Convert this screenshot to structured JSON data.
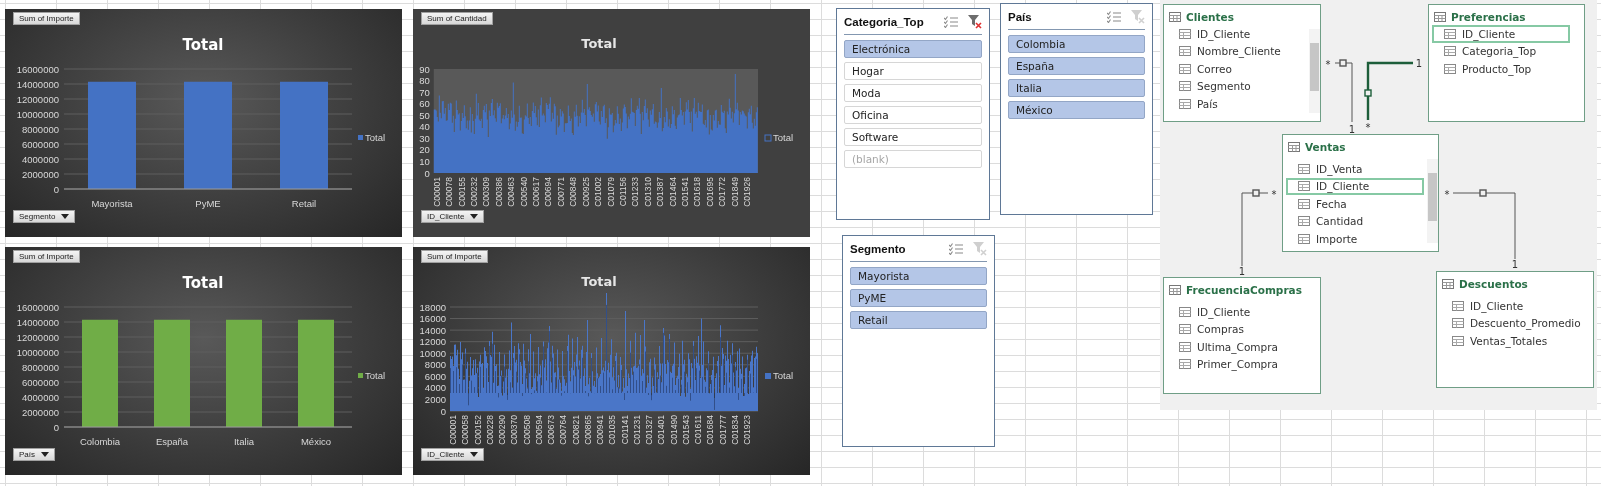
{
  "charts": [
    {
      "kind": "bar_chart",
      "field_button": "Sum of Importe",
      "axis_button": "Segmento",
      "chart_data": {
        "type": "bar",
        "title": "Total",
        "categories": [
          "Mayorista",
          "PyME",
          "Retail"
        ],
        "series": [
          {
            "name": "Total",
            "color": "#4472c4",
            "values": [
              14300000,
              14300000,
              14300000
            ]
          }
        ],
        "grid": true,
        "ylim": [
          0,
          16000000
        ],
        "yticks": [
          0,
          2000000,
          4000000,
          6000000,
          8000000,
          10000000,
          12000000,
          14000000,
          16000000
        ]
      }
    },
    {
      "kind": "dense_chart",
      "field_button": "Sum of Cantidad",
      "axis_button": "ID_Cliente",
      "title": "Total",
      "legend": "Total",
      "y_ticks": [
        "90",
        "80",
        "70",
        "60",
        "50",
        "40",
        "30",
        "20",
        "10",
        "0"
      ],
      "x_labels": [
        "C00001",
        "C00078",
        "C00155",
        "C00232",
        "C00309",
        "C00386",
        "C00463",
        "C00540",
        "C00617",
        "C00694",
        "C00771",
        "C00848",
        "C00925",
        "C01002",
        "C01079",
        "C01156",
        "C01233",
        "C01310",
        "C01387",
        "C01464",
        "C01541",
        "C01618",
        "C01695",
        "C01772",
        "C01849",
        "C01926"
      ]
    },
    {
      "kind": "bar_chart",
      "field_button": "Sum of Importe",
      "axis_button": "País",
      "chart_data": {
        "type": "bar",
        "title": "Total",
        "categories": [
          "Colombia",
          "España",
          "Italia",
          "México"
        ],
        "series": [
          {
            "name": "Total",
            "color": "#70ad47",
            "values": [
              14300000,
              14300000,
              14300000,
              14300000
            ]
          }
        ],
        "grid": true,
        "ylim": [
          0,
          16000000
        ],
        "yticks": [
          0,
          2000000,
          4000000,
          6000000,
          8000000,
          10000000,
          12000000,
          14000000,
          16000000
        ]
      }
    },
    {
      "kind": "dense_chart",
      "field_button": "Sum of Importe",
      "axis_button": "ID_Cliente",
      "title": "Total",
      "legend": "Total",
      "y_ticks": [
        "18000",
        "16000",
        "14000",
        "12000",
        "10000",
        "8000",
        "6000",
        "4000",
        "2000",
        "0"
      ],
      "x_labels": [
        "C00001",
        "C00058",
        "C00152",
        "C00228",
        "C00290",
        "C00370",
        "C00508",
        "C00594",
        "C00673",
        "C00764",
        "C00821",
        "C00865",
        "C00941",
        "C01035",
        "C01141",
        "C01231",
        "C01327",
        "C01401",
        "C01490",
        "C01543",
        "C01611",
        "C01684",
        "C01777",
        "C01834",
        "C01923"
      ]
    }
  ],
  "slicers": [
    {
      "title": "Categoria_Top",
      "filter_active": true,
      "items": [
        {
          "label": "Electrónica",
          "selected": true,
          "disabled": false
        },
        {
          "label": "Hogar",
          "selected": false,
          "disabled": false
        },
        {
          "label": "Moda",
          "selected": false,
          "disabled": false
        },
        {
          "label": "Oficina",
          "selected": false,
          "disabled": false
        },
        {
          "label": "Software",
          "selected": false,
          "disabled": false
        },
        {
          "label": "(blank)",
          "selected": false,
          "disabled": true
        }
      ]
    },
    {
      "title": "País",
      "filter_active": false,
      "items": [
        {
          "label": "Colombia",
          "selected": true,
          "disabled": false
        },
        {
          "label": "España",
          "selected": true,
          "disabled": false
        },
        {
          "label": "Italia",
          "selected": true,
          "disabled": false
        },
        {
          "label": "México",
          "selected": true,
          "disabled": false
        }
      ]
    },
    {
      "title": "Segmento",
      "filter_active": false,
      "items": [
        {
          "label": "Mayorista",
          "selected": true,
          "disabled": false
        },
        {
          "label": "PyME",
          "selected": true,
          "disabled": false
        },
        {
          "label": "Retail",
          "selected": true,
          "disabled": false
        }
      ]
    }
  ],
  "diagram": {
    "tables": [
      {
        "name": "Clientes",
        "scrollable": true,
        "fields": [
          {
            "label": "ID_Cliente",
            "selected": false
          },
          {
            "label": "Nombre_Cliente",
            "selected": false
          },
          {
            "label": "Correo",
            "selected": false
          },
          {
            "label": "Segmento",
            "selected": false
          },
          {
            "label": "País",
            "selected": false
          }
        ]
      },
      {
        "name": "Preferencias",
        "scrollable": false,
        "fields": [
          {
            "label": "ID_Cliente",
            "selected": true
          },
          {
            "label": "Categoria_Top",
            "selected": false
          },
          {
            "label": "Producto_Top",
            "selected": false
          }
        ]
      },
      {
        "name": "Ventas",
        "scrollable": true,
        "fields": [
          {
            "label": "ID_Venta",
            "selected": false
          },
          {
            "label": "ID_Cliente",
            "selected": true
          },
          {
            "label": "Fecha",
            "selected": false
          },
          {
            "label": "Cantidad",
            "selected": false
          },
          {
            "label": "Importe",
            "selected": false
          }
        ]
      },
      {
        "name": "FrecuenciaCompras",
        "scrollable": false,
        "fields": [
          {
            "label": "ID_Cliente",
            "selected": false
          },
          {
            "label": "Compras",
            "selected": false
          },
          {
            "label": "Ultima_Compra",
            "selected": false
          },
          {
            "label": "Primer_Compra",
            "selected": false
          }
        ]
      },
      {
        "name": "Descuentos",
        "scrollable": false,
        "fields": [
          {
            "label": "ID_Cliente",
            "selected": false
          },
          {
            "label": "Descuento_Promedio",
            "selected": false
          },
          {
            "label": "Ventas_Totales",
            "selected": false
          }
        ]
      }
    ],
    "relationships": [
      {
        "many": "*",
        "one": "1",
        "selected": false
      },
      {
        "many": "*",
        "one": "1",
        "selected": true
      },
      {
        "many": "*",
        "one": "1",
        "selected": false
      },
      {
        "many": "*",
        "one": "1",
        "selected": false
      }
    ]
  }
}
